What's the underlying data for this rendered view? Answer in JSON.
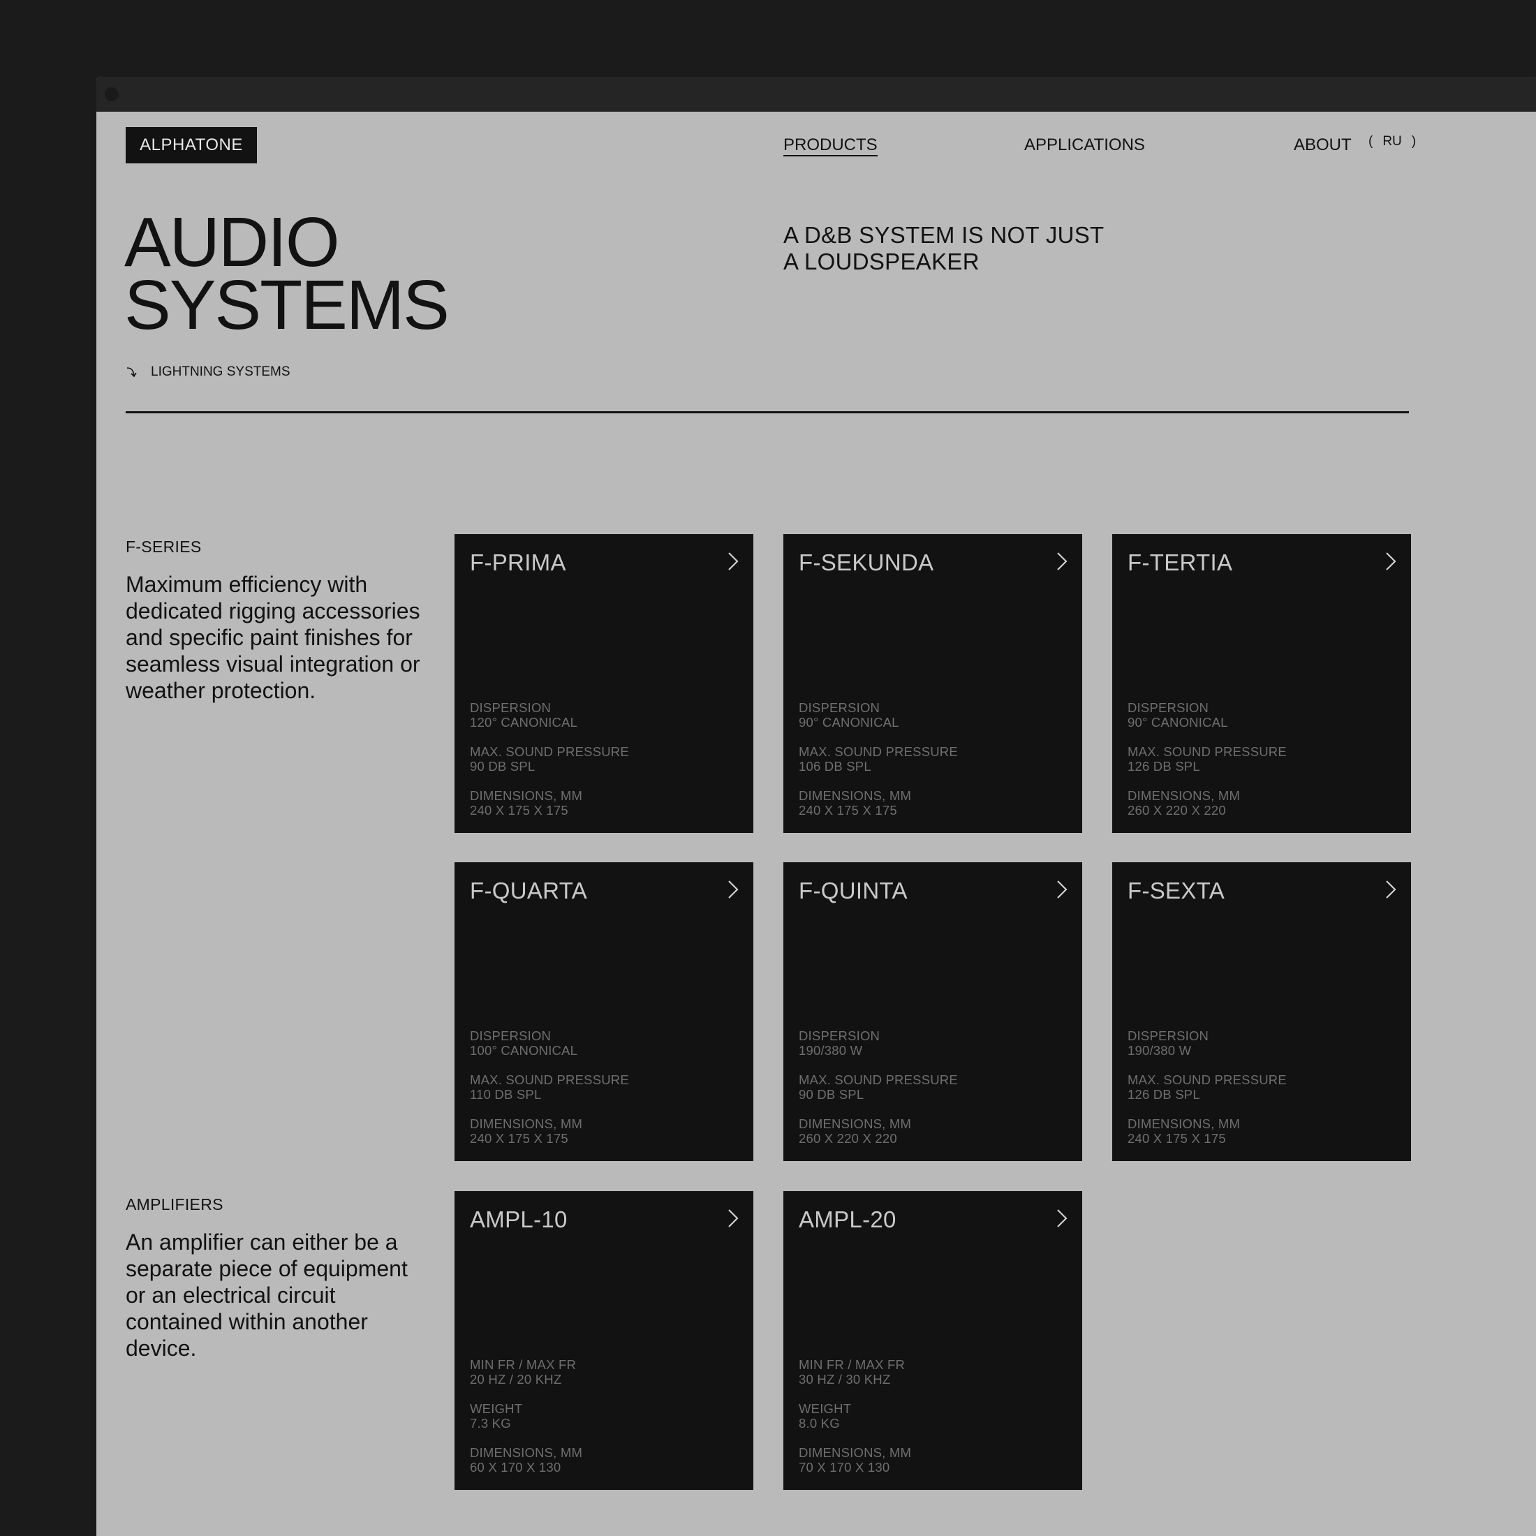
{
  "header": {
    "logo": "ALPHATONE",
    "nav": {
      "products": "PRODUCTS",
      "applications": "APPLICATIONS",
      "about": "ABOUT"
    },
    "lang": {
      "open": "(",
      "code": "RU",
      "close": ")"
    }
  },
  "hero": {
    "title_line1": "AUDIO",
    "title_line2": "SYSTEMS",
    "tagline_line1": "A D&B SYSTEM IS NOT JUST",
    "tagline_line2": "A LOUDSPEAKER",
    "sublink": "LIGHTNING SYSTEMS"
  },
  "sections": {
    "fseries": {
      "label": "F-SERIES",
      "description": "Maximum efficiency with dedicated rigging accessories and specific paint finishes for seamless visual integration or weather protection."
    },
    "amplifiers": {
      "label": "AMPLIFIERS",
      "description": "An amplifier can either be a separate piece of equipment or an electrical circuit contained within another device."
    }
  },
  "products": [
    {
      "name": "F-PRIMA",
      "specs": [
        {
          "label": "DISPERSION",
          "value": "120° CANONICAL"
        },
        {
          "label": "MAX. SOUND PRESSURE",
          "value": "90 DB SPL"
        },
        {
          "label": "DIMENSIONS, MM",
          "value": "240 X 175 X 175"
        }
      ]
    },
    {
      "name": "F-SEKUNDA",
      "specs": [
        {
          "label": "DISPERSION",
          "value": "90° CANONICAL"
        },
        {
          "label": "MAX. SOUND PRESSURE",
          "value": "106 DB SPL"
        },
        {
          "label": "DIMENSIONS, MM",
          "value": "240 X 175 X 175"
        }
      ]
    },
    {
      "name": "F-TERTIA",
      "specs": [
        {
          "label": "DISPERSION",
          "value": "90° CANONICAL"
        },
        {
          "label": "MAX. SOUND PRESSURE",
          "value": "126 DB SPL"
        },
        {
          "label": "DIMENSIONS, MM",
          "value": "260 X 220 X 220"
        }
      ]
    },
    {
      "name": "F-QUARTA",
      "specs": [
        {
          "label": "DISPERSION",
          "value": "100° CANONICAL"
        },
        {
          "label": "MAX. SOUND PRESSURE",
          "value": "110 DB SPL"
        },
        {
          "label": "DIMENSIONS, MM",
          "value": "240 X 175 X 175"
        }
      ]
    },
    {
      "name": "F-QUINTA",
      "specs": [
        {
          "label": "DISPERSION",
          "value": "190/380 W"
        },
        {
          "label": "MAX. SOUND PRESSURE",
          "value": "90 DB SPL"
        },
        {
          "label": "DIMENSIONS, MM",
          "value": "260 X 220 X 220"
        }
      ]
    },
    {
      "name": "F-SEXTA",
      "specs": [
        {
          "label": "DISPERSION",
          "value": "190/380 W"
        },
        {
          "label": "MAX. SOUND PRESSURE",
          "value": "126 DB SPL"
        },
        {
          "label": "DIMENSIONS, MM",
          "value": "240 X 175 X 175"
        }
      ]
    },
    {
      "name": "AMPL-10",
      "specs": [
        {
          "label": "MIN FR / MAX FR",
          "value": "20 HZ / 20 KHZ"
        },
        {
          "label": "WEIGHT",
          "value": "7.3 KG"
        },
        {
          "label": "DIMENSIONS, MM",
          "value": "60 X 170 X 130"
        }
      ]
    },
    {
      "name": "AMPL-20",
      "specs": [
        {
          "label": "MIN FR / MAX FR",
          "value": "30 HZ / 30 KHZ"
        },
        {
          "label": "WEIGHT",
          "value": "8.0 KG"
        },
        {
          "label": "DIMENSIONS, MM",
          "value": "70 X 170 X 130"
        }
      ]
    }
  ],
  "icons": {
    "card_link": "chevron-right-icon",
    "sublink": "arrow-down-right-icon"
  },
  "colors": {
    "background": "#bababa",
    "card": "#121212",
    "frame": "#1b1b1b"
  }
}
